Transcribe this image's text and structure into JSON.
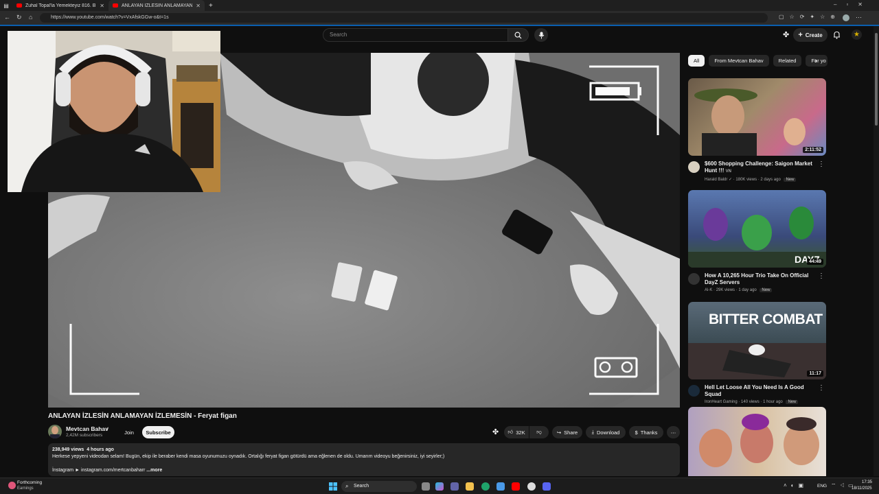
{
  "browser": {
    "tabs": [
      {
        "label": "Zuhal Topal'la Yemekteyiz 816. B..."
      },
      {
        "label": "ANLAYAN İZLESİN ANLAMAYAN İ..."
      }
    ],
    "url": "https://www.youtube.com/watch?v=VxAfskGGw-o&t=1s"
  },
  "header": {
    "search_placeholder": "Search",
    "create_label": "Create"
  },
  "video": {
    "title": "ANLAYAN İZLESİN ANLAMAYAN İZLEMESİN - Feryat figan",
    "channel": "Mevtcan Bahav",
    "subscribers": "2,42M subscribers",
    "join_label": "Join",
    "subscribe_label": "Subscribe",
    "likes": "32K",
    "share_label": "Share",
    "download_label": "Download",
    "thanks_label": "Thanks",
    "views": "238,949 views",
    "age": "4 hours ago",
    "description": "Herkese yepyeni videodan selam! Bugün, ekip ile beraber kendi masa oyunumuzu oynadık. Ortalığı feryat figan götürdü ama eğlenen de oldu. Umarım videoyu beğenirsiniz, iyi seyirler;)",
    "instagram_line": "İnstagram ► instagram.com/mertcanbaharr",
    "more_label": "...more"
  },
  "chips": [
    "All",
    "From Mevtcan Bahav",
    "Related",
    "For yo"
  ],
  "recommendations": [
    {
      "title": "$600 Shopping Challenge: Saigon Market Hunt !!!",
      "title_suffix": "VN",
      "channel": "Harald Baldr",
      "views": "180K views",
      "age": "2 days ago",
      "badge": "New",
      "duration": "2:11:52",
      "color": "#6a5a48"
    },
    {
      "title": "How A 10,265 Hour Trio Take On Official DayZ Servers",
      "title_suffix": "",
      "channel": "Al-K",
      "views": "29K views",
      "age": "1 day ago",
      "badge": "New",
      "duration": "44:49",
      "color": "#3f5f9a"
    },
    {
      "title": "Hell Let Loose All You Need Is A Good Squad",
      "title_suffix": "",
      "channel": "IronHeart Gaming",
      "views": "140 views",
      "age": "1 hour ago",
      "badge": "New",
      "duration": "11:17",
      "color": "#4a5a66",
      "thumb_text": "BITTER COMBAT"
    },
    {
      "title": "",
      "title_suffix": "",
      "channel": "",
      "views": "",
      "age": "",
      "badge": "",
      "duration": "",
      "color": "#b08070"
    }
  ],
  "taskbar": {
    "weather_title": "Forthcoming",
    "weather_sub": "Earnings",
    "search_label": "Search",
    "lang": "ENG",
    "time": "17:35",
    "date": "18/11/2025"
  },
  "colors": {
    "accent": "#ff0000",
    "background": "#0f0f0f",
    "chip_bg": "#272727"
  }
}
